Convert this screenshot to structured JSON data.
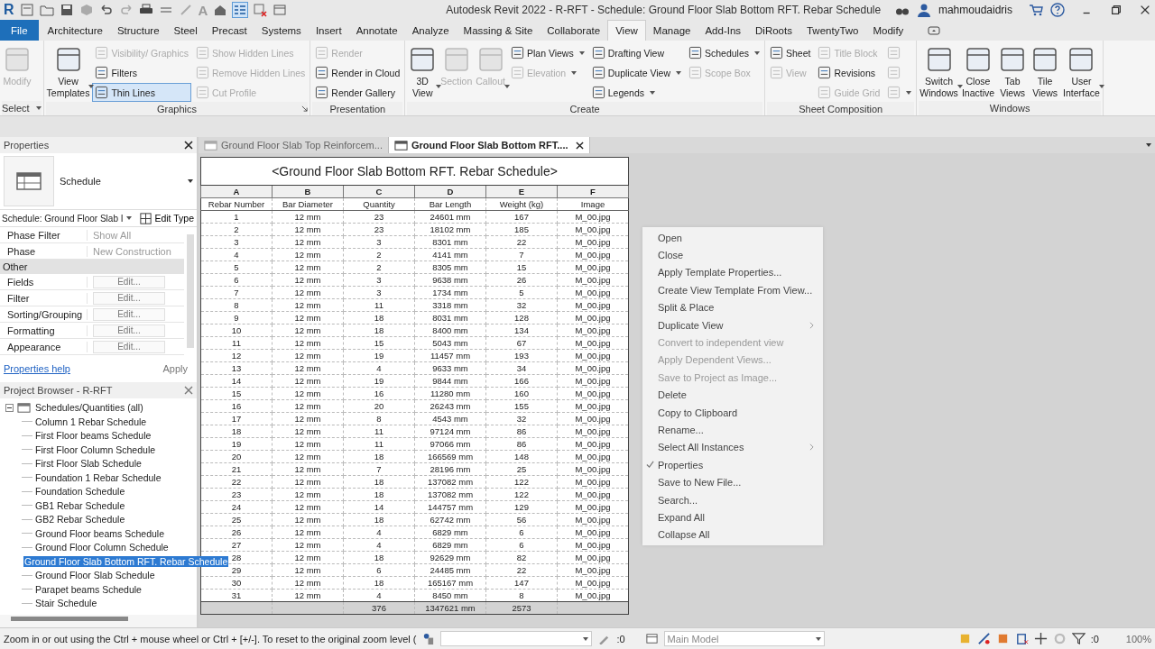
{
  "title_bar": {
    "app_logo": "R",
    "text_tool": "A",
    "title": "Autodesk Revit 2022 - R-RFT - Schedule: Ground Floor Slab Bottom RFT. Rebar Schedule",
    "user": "mahmoudaidris"
  },
  "ribbon_tabs": [
    {
      "label": "File",
      "kind": "file",
      "selected": false
    },
    {
      "label": "Architecture",
      "kind": "tab",
      "selected": false
    },
    {
      "label": "Structure",
      "kind": "tab",
      "selected": false
    },
    {
      "label": "Steel",
      "kind": "tab",
      "selected": false
    },
    {
      "label": "Precast",
      "kind": "tab",
      "selected": false
    },
    {
      "label": "Systems",
      "kind": "tab",
      "selected": false
    },
    {
      "label": "Insert",
      "kind": "tab",
      "selected": false
    },
    {
      "label": "Annotate",
      "kind": "tab",
      "selected": false
    },
    {
      "label": "Analyze",
      "kind": "tab",
      "selected": false
    },
    {
      "label": "Massing & Site",
      "kind": "tab",
      "selected": false
    },
    {
      "label": "Collaborate",
      "kind": "tab",
      "selected": false
    },
    {
      "label": "View",
      "kind": "tab",
      "selected": true
    },
    {
      "label": "Manage",
      "kind": "tab",
      "selected": false
    },
    {
      "label": "Add-Ins",
      "kind": "tab",
      "selected": false
    },
    {
      "label": "DiRoots",
      "kind": "tab",
      "selected": false
    },
    {
      "label": "TwentyTwo",
      "kind": "tab",
      "selected": false
    },
    {
      "label": "Modify",
      "kind": "tab",
      "selected": false
    }
  ],
  "ribbon_panels": [
    {
      "label": "Select",
      "launcher": false,
      "menu": true,
      "groups": [
        {
          "kind": "large",
          "label": "Modify",
          "disabled": true,
          "menu": false
        }
      ]
    },
    {
      "label": "Graphics",
      "launcher": true,
      "menu": false,
      "groups": [
        {
          "kind": "large",
          "label": "View Templates",
          "disabled": false,
          "menu": true
        },
        {
          "kind": "stack",
          "items": [
            {
              "label": "Visibility/ Graphics",
              "disabled": true,
              "active": false,
              "menu": false
            },
            {
              "label": "Filters",
              "disabled": false,
              "active": false,
              "menu": false
            },
            {
              "label": "Thin Lines",
              "disabled": false,
              "active": true,
              "menu": false
            }
          ]
        },
        {
          "kind": "stack",
          "items": [
            {
              "label": "Show Hidden Lines",
              "disabled": true,
              "active": false,
              "menu": false
            },
            {
              "label": "Remove Hidden Lines",
              "disabled": true,
              "active": false,
              "menu": false
            },
            {
              "label": "Cut Profile",
              "disabled": true,
              "active": false,
              "menu": false
            }
          ]
        }
      ]
    },
    {
      "label": "Presentation",
      "launcher": false,
      "menu": false,
      "groups": [
        {
          "kind": "stack",
          "items": [
            {
              "label": "Render",
              "disabled": true,
              "active": false,
              "menu": false
            },
            {
              "label": "Render in Cloud",
              "disabled": false,
              "active": false,
              "menu": false
            },
            {
              "label": "Render Gallery",
              "disabled": false,
              "active": false,
              "menu": false
            }
          ]
        }
      ]
    },
    {
      "label": "Create",
      "launcher": false,
      "menu": false,
      "groups": [
        {
          "kind": "large",
          "label": "3D View",
          "disabled": false,
          "menu": true
        },
        {
          "kind": "large",
          "label": "Section",
          "disabled": true,
          "menu": false
        },
        {
          "kind": "large",
          "label": "Callout",
          "disabled": true,
          "menu": true
        },
        {
          "kind": "stack",
          "items": [
            {
              "label": "Plan Views",
              "disabled": false,
              "active": false,
              "menu": true
            },
            {
              "label": "Elevation",
              "disabled": true,
              "active": false,
              "menu": true
            }
          ]
        },
        {
          "kind": "stack",
          "items": [
            {
              "label": "Drafting View",
              "disabled": false,
              "active": false,
              "menu": false
            },
            {
              "label": "Duplicate View",
              "disabled": false,
              "active": false,
              "menu": true
            },
            {
              "label": "Legends",
              "disabled": false,
              "active": false,
              "menu": true
            }
          ]
        },
        {
          "kind": "stack",
          "items": [
            {
              "label": "Schedules",
              "disabled": false,
              "active": false,
              "menu": true
            },
            {
              "label": "Scope Box",
              "disabled": true,
              "active": false,
              "menu": false
            }
          ]
        }
      ]
    },
    {
      "label": "Sheet Composition",
      "launcher": false,
      "menu": false,
      "groups": [
        {
          "kind": "stack",
          "items": [
            {
              "label": "Sheet",
              "disabled": false,
              "active": false,
              "menu": false
            },
            {
              "label": "View",
              "disabled": true,
              "active": false,
              "menu": false
            }
          ]
        },
        {
          "kind": "stack",
          "items": [
            {
              "label": "Title Block",
              "disabled": true,
              "active": false,
              "menu": false
            },
            {
              "label": "Revisions",
              "disabled": false,
              "active": false,
              "menu": false
            },
            {
              "label": "Guide Grid",
              "disabled": true,
              "active": false,
              "menu": false
            }
          ]
        },
        {
          "kind": "stack",
          "items": [
            {
              "disabled": true,
              "active": false,
              "menu": false
            },
            {
              "disabled": true,
              "active": false,
              "menu": false
            },
            {
              "disabled": true,
              "active": false,
              "menu": true
            }
          ]
        }
      ]
    },
    {
      "label": "Windows",
      "launcher": false,
      "menu": false,
      "groups": [
        {
          "kind": "large",
          "label": "Switch Windows",
          "disabled": false,
          "menu": true
        },
        {
          "kind": "large",
          "label": "Close Inactive",
          "disabled": false,
          "menu": false
        },
        {
          "kind": "large",
          "label": "Tab Views",
          "disabled": false,
          "menu": false
        },
        {
          "kind": "large",
          "label": "Tile Views",
          "disabled": false,
          "menu": false
        },
        {
          "kind": "large",
          "label": "User Interface",
          "disabled": false,
          "menu": true
        }
      ]
    }
  ],
  "properties": {
    "title": "Properties",
    "type_name": "Schedule",
    "instance_selector": "Schedule: Ground Floor Slab I",
    "edit_type": "Edit Type",
    "rows": [
      {
        "kind": "param",
        "name": "Phase Filter",
        "value": "Show All"
      },
      {
        "kind": "param",
        "name": "Phase",
        "value": "New Construction"
      },
      {
        "kind": "category",
        "name": "Other"
      },
      {
        "kind": "button",
        "name": "Fields",
        "value": "Edit..."
      },
      {
        "kind": "button",
        "name": "Filter",
        "value": "Edit..."
      },
      {
        "kind": "button",
        "name": "Sorting/Grouping",
        "value": "Edit..."
      },
      {
        "kind": "button",
        "name": "Formatting",
        "value": "Edit..."
      },
      {
        "kind": "button",
        "name": "Appearance",
        "value": "Edit..."
      }
    ],
    "help_link": "Properties help",
    "apply": "Apply"
  },
  "project_browser": {
    "title": "Project Browser - R-RFT",
    "tree": [
      {
        "label": "Schedules/Quantities (all)",
        "expanded": true,
        "selected": false,
        "children": [
          {
            "label": "Column 1 Rebar Schedule",
            "selected": false
          },
          {
            "label": "First Floor beams Schedule",
            "selected": false
          },
          {
            "label": "First Floor Column Schedule",
            "selected": false
          },
          {
            "label": "First Floor Slab Schedule",
            "selected": false
          },
          {
            "label": "Foundation 1 Rebar Schedule",
            "selected": false
          },
          {
            "label": "Foundation Schedule",
            "selected": false
          },
          {
            "label": "GB1 Rebar Schedule",
            "selected": false
          },
          {
            "label": "GB2 Rebar Schedule",
            "selected": false
          },
          {
            "label": "Ground Floor beams Schedule",
            "selected": false
          },
          {
            "label": "Ground Floor Column Schedule",
            "selected": false
          },
          {
            "label": "Ground Floor Slab Bottom RFT. Rebar Schedule",
            "selected": true
          },
          {
            "label": "Ground Floor Slab Schedule",
            "selected": false
          },
          {
            "label": "Parapet beams Schedule",
            "selected": false
          },
          {
            "label": "Stair Schedule",
            "selected": false
          }
        ]
      }
    ]
  },
  "context_menu": {
    "items": [
      {
        "label": "Open",
        "disabled": false,
        "submenu": false,
        "checked": false
      },
      {
        "label": "Close",
        "disabled": false,
        "submenu": false,
        "checked": false
      },
      {
        "label": "Apply Template Properties...",
        "disabled": false,
        "submenu": false,
        "checked": false
      },
      {
        "label": "Create View Template From View...",
        "disabled": false,
        "submenu": false,
        "checked": false
      },
      {
        "label": "Split & Place",
        "disabled": false,
        "submenu": false,
        "checked": false
      },
      {
        "label": "Duplicate View",
        "disabled": false,
        "submenu": true,
        "checked": false
      },
      {
        "label": "Convert to independent view",
        "disabled": true,
        "submenu": false,
        "checked": false
      },
      {
        "label": "Apply Dependent Views...",
        "disabled": true,
        "submenu": false,
        "checked": false
      },
      {
        "label": "Save to Project as Image...",
        "disabled": true,
        "submenu": false,
        "checked": false
      },
      {
        "label": "Delete",
        "disabled": false,
        "submenu": false,
        "checked": false
      },
      {
        "label": "Copy to Clipboard",
        "disabled": false,
        "submenu": false,
        "checked": false
      },
      {
        "label": "Rename...",
        "disabled": false,
        "submenu": false,
        "checked": false
      },
      {
        "label": "Select All Instances",
        "disabled": false,
        "submenu": true,
        "checked": false
      },
      {
        "label": "Properties",
        "disabled": false,
        "submenu": false,
        "checked": true
      },
      {
        "label": "Save to New File...",
        "disabled": false,
        "submenu": false,
        "checked": false
      },
      {
        "label": "Search...",
        "disabled": false,
        "submenu": false,
        "checked": false
      },
      {
        "label": "Expand All",
        "disabled": false,
        "submenu": false,
        "checked": false
      },
      {
        "label": "Collapse All",
        "disabled": false,
        "submenu": false,
        "checked": false
      }
    ]
  },
  "view_tabs": [
    {
      "label": "Ground Floor Slab Top Reinforcem...",
      "selected": false
    },
    {
      "label": "Ground Floor Slab Bottom RFT....",
      "selected": true
    }
  ],
  "schedule": {
    "title": "<Ground Floor Slab Bottom RFT. Rebar Schedule>",
    "letters": [
      "A",
      "B",
      "C",
      "D",
      "E",
      "F"
    ],
    "columns": [
      "Rebar Number",
      "Bar Diameter",
      "Quantity",
      "Bar Length",
      "Weight (kg)",
      "Image"
    ],
    "rows": [
      [
        "1",
        "12 mm",
        "23",
        "24601 mm",
        "167",
        "M_00.jpg"
      ],
      [
        "2",
        "12 mm",
        "23",
        "18102 mm",
        "185",
        "M_00.jpg"
      ],
      [
        "3",
        "12 mm",
        "3",
        "8301 mm",
        "22",
        "M_00.jpg"
      ],
      [
        "4",
        "12 mm",
        "2",
        "4141 mm",
        "7",
        "M_00.jpg"
      ],
      [
        "5",
        "12 mm",
        "2",
        "8305 mm",
        "15",
        "M_00.jpg"
      ],
      [
        "6",
        "12 mm",
        "3",
        "9638 mm",
        "26",
        "M_00.jpg"
      ],
      [
        "7",
        "12 mm",
        "3",
        "1734 mm",
        "5",
        "M_00.jpg"
      ],
      [
        "8",
        "12 mm",
        "11",
        "3318 mm",
        "32",
        "M_00.jpg"
      ],
      [
        "9",
        "12 mm",
        "18",
        "8031 mm",
        "128",
        "M_00.jpg"
      ],
      [
        "10",
        "12 mm",
        "18",
        "8400 mm",
        "134",
        "M_00.jpg"
      ],
      [
        "11",
        "12 mm",
        "15",
        "5043 mm",
        "67",
        "M_00.jpg"
      ],
      [
        "12",
        "12 mm",
        "19",
        "11457 mm",
        "193",
        "M_00.jpg"
      ],
      [
        "13",
        "12 mm",
        "4",
        "9633 mm",
        "34",
        "M_00.jpg"
      ],
      [
        "14",
        "12 mm",
        "19",
        "9844 mm",
        "166",
        "M_00.jpg"
      ],
      [
        "15",
        "12 mm",
        "16",
        "11280 mm",
        "160",
        "M_00.jpg"
      ],
      [
        "16",
        "12 mm",
        "20",
        "26243 mm",
        "155",
        "M_00.jpg"
      ],
      [
        "17",
        "12 mm",
        "8",
        "4543 mm",
        "32",
        "M_00.jpg"
      ],
      [
        "18",
        "12 mm",
        "11",
        "97124 mm",
        "86",
        "M_00.jpg"
      ],
      [
        "19",
        "12 mm",
        "11",
        "97066 mm",
        "86",
        "M_00.jpg"
      ],
      [
        "20",
        "12 mm",
        "18",
        "166569 mm",
        "148",
        "M_00.jpg"
      ],
      [
        "21",
        "12 mm",
        "7",
        "28196 mm",
        "25",
        "M_00.jpg"
      ],
      [
        "22",
        "12 mm",
        "18",
        "137082 mm",
        "122",
        "M_00.jpg"
      ],
      [
        "23",
        "12 mm",
        "18",
        "137082 mm",
        "122",
        "M_00.jpg"
      ],
      [
        "24",
        "12 mm",
        "14",
        "144757 mm",
        "129",
        "M_00.jpg"
      ],
      [
        "25",
        "12 mm",
        "18",
        "62742 mm",
        "56",
        "M_00.jpg"
      ],
      [
        "26",
        "12 mm",
        "4",
        "6829 mm",
        "6",
        "M_00.jpg"
      ],
      [
        "27",
        "12 mm",
        "4",
        "6829 mm",
        "6",
        "M_00.jpg"
      ],
      [
        "28",
        "12 mm",
        "18",
        "92629 mm",
        "82",
        "M_00.jpg"
      ],
      [
        "29",
        "12 mm",
        "6",
        "24485 mm",
        "22",
        "M_00.jpg"
      ],
      [
        "30",
        "12 mm",
        "18",
        "165167 mm",
        "147",
        "M_00.jpg"
      ],
      [
        "31",
        "12 mm",
        "4",
        "8450 mm",
        "8",
        "M_00.jpg"
      ]
    ],
    "totals": {
      "quantity": "376",
      "bar_length": "1347621 mm",
      "weight": "2573"
    }
  },
  "status_bar": {
    "message": "Zoom in or out using the Ctrl + mouse wheel or Ctrl + [+/-]. To reset to the original zoom level (",
    "editable_count": ":0",
    "model": "Main Model",
    "filter_count": ":0",
    "zoom": "100%"
  }
}
